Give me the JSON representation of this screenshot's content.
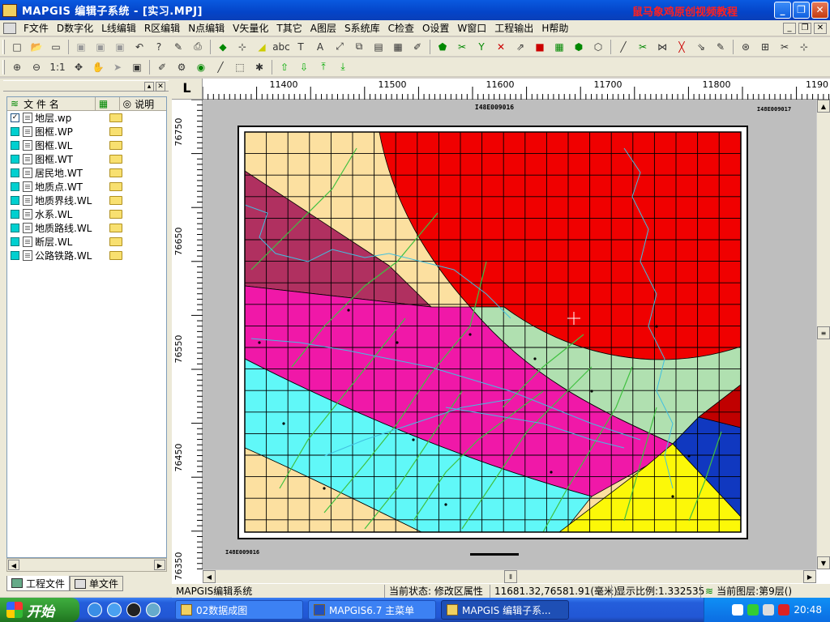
{
  "window": {
    "app_title": "MAPGIS 编辑子系统 - [实习.MPJ]",
    "watermark": "鼠马象鸡原创视频教程"
  },
  "menu": [
    {
      "label": "F文件"
    },
    {
      "label": "D数字化"
    },
    {
      "label": "L线编辑"
    },
    {
      "label": "R区编辑"
    },
    {
      "label": "N点编辑"
    },
    {
      "label": "V矢量化"
    },
    {
      "label": "T其它"
    },
    {
      "label": "A图层"
    },
    {
      "label": "S系统库"
    },
    {
      "label": "C检查"
    },
    {
      "label": "O设置"
    },
    {
      "label": "W窗口"
    },
    {
      "label": "工程输出"
    },
    {
      "label": "H帮助"
    }
  ],
  "toolbar2": {
    "zoom_label": "1:1"
  },
  "layer_panel": {
    "col_name": "文 件 名",
    "col_desc": "说明",
    "files": [
      {
        "name": "地层.wp",
        "checked": true
      },
      {
        "name": "图框.WP"
      },
      {
        "name": "图框.WL"
      },
      {
        "name": "图框.WT"
      },
      {
        "name": "居民地.WT"
      },
      {
        "name": "地质点.WT"
      },
      {
        "name": "地质界线.WL"
      },
      {
        "name": "水系.WL"
      },
      {
        "name": "地质路线.WL"
      },
      {
        "name": "断层.WL"
      },
      {
        "name": "公路铁路.WL"
      }
    ],
    "tabs": [
      {
        "label": "工程文件"
      },
      {
        "label": "单文件"
      }
    ]
  },
  "rulers": {
    "corner": "L",
    "x_ticks": [
      "11400",
      "11500",
      "11600",
      "11700",
      "11800",
      "1190"
    ],
    "y_ticks": [
      "76750",
      "76650",
      "76550",
      "76450",
      "76350"
    ]
  },
  "map": {
    "sheet_code_top": "I48E009016",
    "sheet_code_right": "I48E009017",
    "sheet_code_bottom": "I48E009016",
    "colors": {
      "tan": "#fce0a0",
      "red": "#f00000",
      "maroon": "#b03060",
      "pink": "#f018a8",
      "mint": "#b0e0b0",
      "cyan": "#60f8f8",
      "yellow": "#fcf808",
      "blue": "#1038c0",
      "darkred": "#c00000",
      "grid": "#000000",
      "green_line": "#40c040",
      "river": "#40c0e0"
    }
  },
  "status": {
    "app_name": "MAPGIS编辑系统",
    "state": "当前状态: 修改区属性",
    "coords": "11681.32,76581.91(毫米)",
    "scale": "显示比例:1.332535",
    "layer": "当前图层:第9层()"
  },
  "taskbar": {
    "start": "开始",
    "tasks": [
      {
        "label": "02数据成图"
      },
      {
        "label": "MAPGIS6.7 主菜单"
      },
      {
        "label": "MAPGIS 编辑子系..."
      }
    ],
    "clock": "20:48"
  }
}
